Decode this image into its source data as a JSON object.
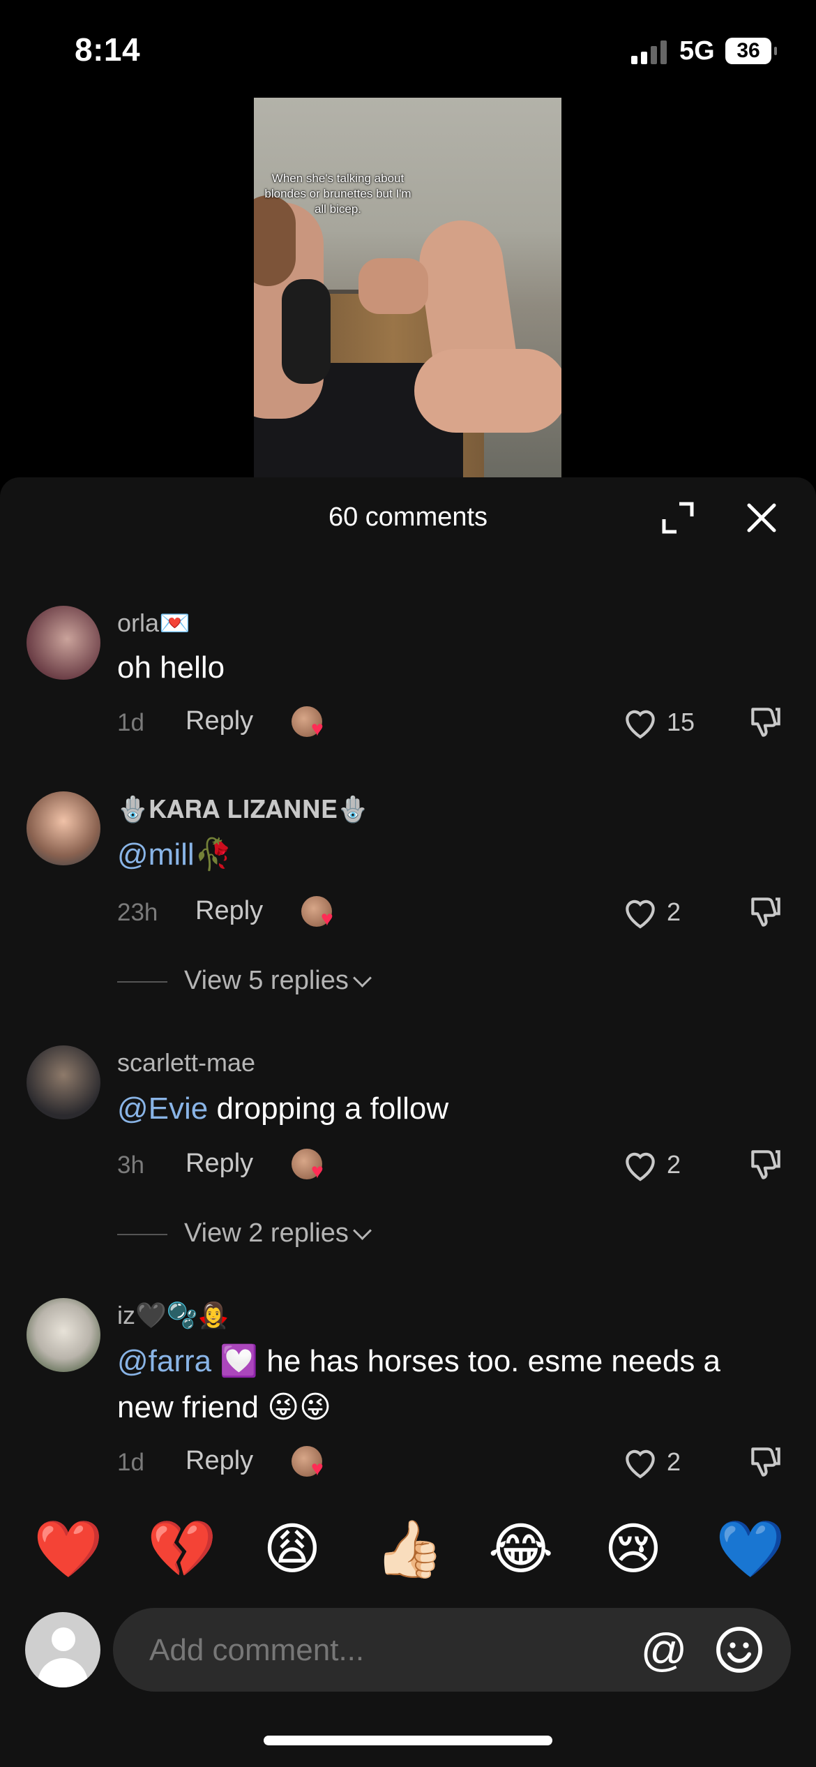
{
  "status_bar": {
    "time": "8:14",
    "network": "5G",
    "battery": "36"
  },
  "video": {
    "caption": "When she's talking about blondes or brunettes but I'm all bicep."
  },
  "panel": {
    "title": "60 comments"
  },
  "comments": [
    {
      "username": "orla💌",
      "text": "oh hello",
      "mention": "",
      "age": "1d",
      "reply_label": "Reply",
      "likes": "15",
      "replies": ""
    },
    {
      "username": "🪬𝐊𝐀𝐑𝐀 𝐋𝐈𝐙𝐀𝐍𝐍𝐄🪬",
      "text": "🥀",
      "mention": "@mill",
      "age": "23h",
      "reply_label": "Reply",
      "likes": "2",
      "replies": "View 5 replies"
    },
    {
      "username": "scarlett-mae",
      "text": " dropping a follow",
      "mention": "@Evie",
      "age": "3h",
      "reply_label": "Reply",
      "likes": "2",
      "replies": "View 2 replies"
    },
    {
      "username": "iz🖤🫧🧛‍♀️",
      "text": " 💟 he has horses too. esme needs a new friend 😜😜",
      "mention": "@farra",
      "age": "1d",
      "reply_label": "Reply",
      "likes": "2",
      "replies": ""
    }
  ],
  "emoji_bar": [
    "❤️",
    "💔",
    "😩",
    "👍🏻",
    "😂",
    "😢",
    "💙"
  ],
  "input": {
    "placeholder": "Add comment...",
    "at_label": "@"
  },
  "colors": {
    "panel_bg": "#121212",
    "mention": "#89b4e6",
    "muted": "#7b7b7b"
  }
}
